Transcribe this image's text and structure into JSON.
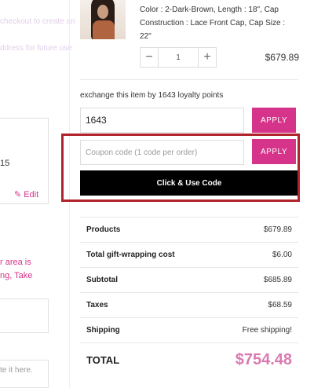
{
  "left": {
    "faint_1": "checkout to create an",
    "faint_2": "ddress for future use",
    "number": "15",
    "edit_label": "Edit",
    "notice_line1": "r area is",
    "notice_line2": "ng, Take",
    "comment_placeholder": "te it here."
  },
  "product": {
    "description": "Color : 2-Dark-Brown, Length : 18\", Cap Construction : Lace Front Cap, Cap Size : 22\"",
    "quantity": "1",
    "price": "$679.89",
    "minus_label": "−",
    "plus_label": "+"
  },
  "loyalty": {
    "text": "exchange this item by 1643 loyalty points",
    "points_value": "1643",
    "apply_label": "APPLY"
  },
  "coupon": {
    "placeholder": "Coupon code (1 code per order)",
    "apply_label": "APPLY",
    "use_code_label": "Click & Use Code"
  },
  "totals": {
    "rows": [
      {
        "label": "Products",
        "value": "$679.89"
      },
      {
        "label": "Total gift-wrapping cost",
        "value": "$6.00"
      },
      {
        "label": "Subtotal",
        "value": "$685.89"
      },
      {
        "label": "Taxes",
        "value": "$68.59"
      },
      {
        "label": "Shipping",
        "value": "Free shipping!"
      }
    ],
    "total_label": "TOTAL",
    "total_value": "$754.48"
  },
  "colors": {
    "accent": "#d6338a",
    "total_value": "#d97ab0",
    "highlight_border": "#b1232b"
  }
}
